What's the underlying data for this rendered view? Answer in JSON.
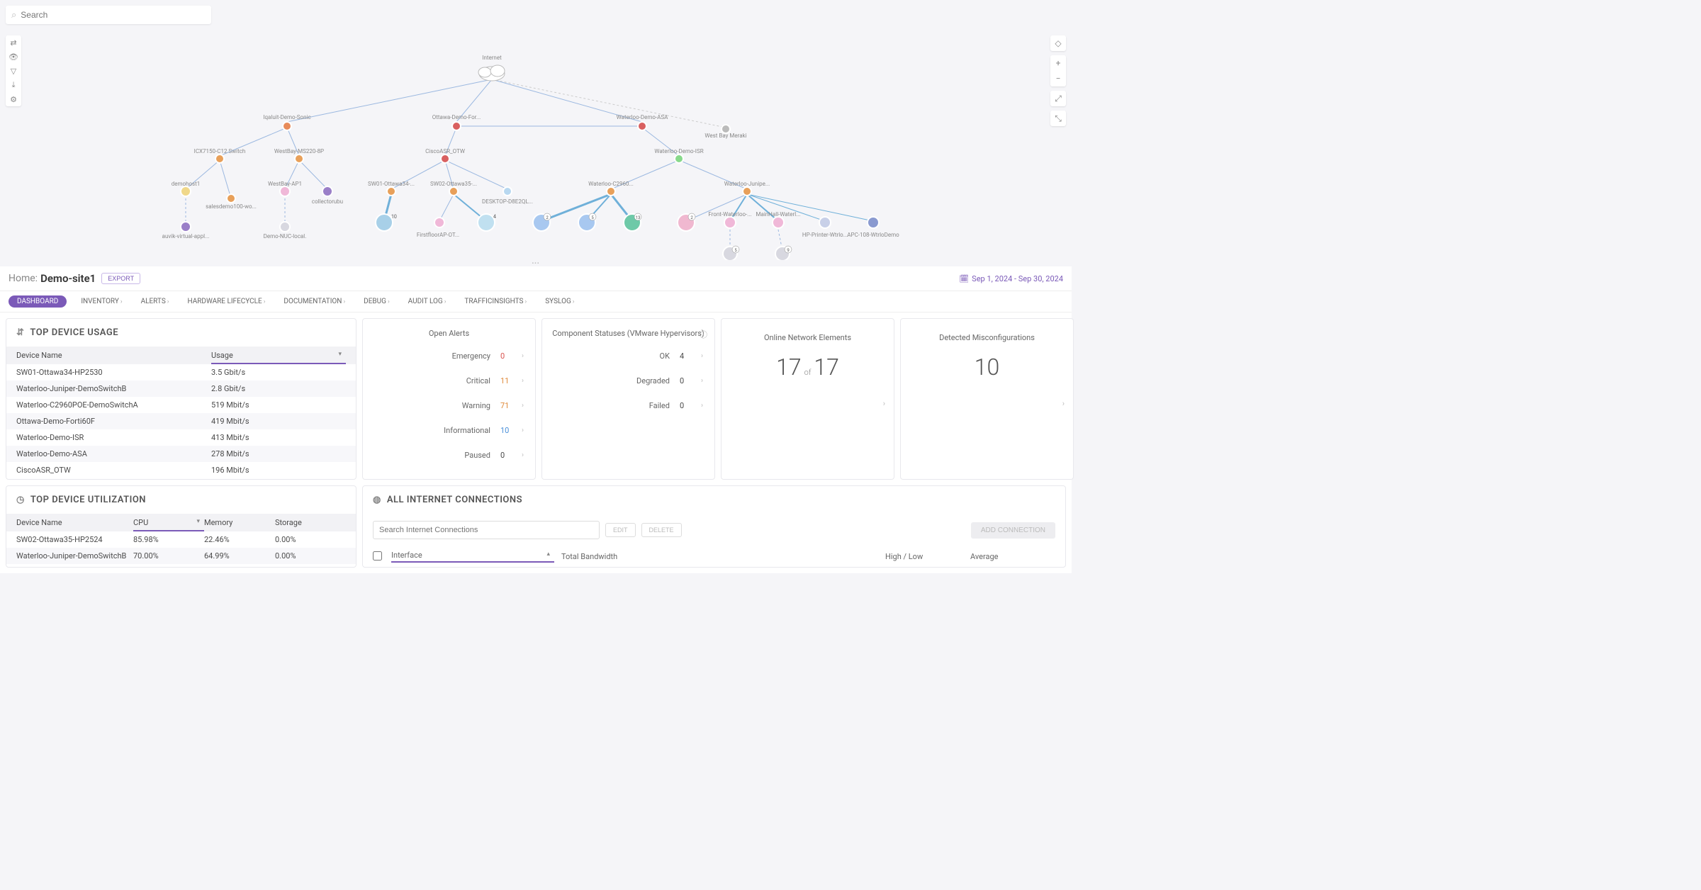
{
  "search": {
    "placeholder": "Search"
  },
  "date_range": "Sep 1, 2024 - Sep 30, 2024",
  "breadcrumb": {
    "home": "Home:",
    "site": "Demo-site1",
    "export": "EXPORT"
  },
  "tabs": [
    "DASHBOARD",
    "INVENTORY",
    "ALERTS",
    "HARDWARE LIFECYCLE",
    "DOCUMENTATION",
    "DEBUG",
    "AUDIT LOG",
    "TRAFFICINSIGHTS",
    "SYSLOG"
  ],
  "topology": {
    "root": "Internet",
    "nodes": {
      "iqaluit": "Iqaluit-Demo-Sonic",
      "ottawa": "Ottawa-Demo-For...",
      "waterloo": "Waterloo-Demo-ASA",
      "westbay": "West Bay Meraki",
      "icx": "ICX7150-C12 Switch",
      "ms220": "WestBay-MS220-8P",
      "ciscoasr": "CiscoASR_OTW",
      "isr": "Waterloo-Demo-ISR",
      "demohost": "demohost1",
      "westbayap": "WestBay-AP1",
      "collector": "collectorubu",
      "sw01": "SW01-Ottawa34-...",
      "sw02": "SW02-Ottawa35-...",
      "desktop": "DESKTOP-D8E2QL...",
      "c2960": "Waterloo-C2960...",
      "junipe": "Waterloo-Junipe...",
      "auvik": "auvik-virtual-appl...",
      "salesdemo": "salesdemo100-wo...",
      "demonuc": "Demo-NUC-local.",
      "firstfloor": "FirstfloorAP-OT...",
      "front": "Front-Waterloo-...",
      "mainhall": "MainHall-Waterl...",
      "hpprinter": "HP-Printer-Wtrlo...",
      "apc": "APC-108-WtrloDemo"
    },
    "badges": {
      "sw01b": "10",
      "sw02b": "4",
      "c2960_a": "2",
      "c2960_b": "5",
      "c2960_c": "13",
      "junipe_a": "2",
      "front_b": "5",
      "mainhall_b": "9"
    }
  },
  "top_usage": {
    "title": "TOP DEVICE USAGE",
    "cols": [
      "Device Name",
      "Usage"
    ],
    "rows": [
      {
        "name": "SW01-Ottawa34-HP2530",
        "usage": "3.5 Gbit/s"
      },
      {
        "name": "Waterloo-Juniper-DemoSwitchB",
        "usage": "2.8 Gbit/s"
      },
      {
        "name": "Waterloo-C2960POE-DemoSwitchA",
        "usage": "519 Mbit/s"
      },
      {
        "name": "Ottawa-Demo-Forti60F",
        "usage": "419 Mbit/s"
      },
      {
        "name": "Waterloo-Demo-ISR",
        "usage": "413 Mbit/s"
      },
      {
        "name": "Waterloo-Demo-ASA",
        "usage": "278 Mbit/s"
      },
      {
        "name": "CiscoASR_OTW",
        "usage": "196 Mbit/s"
      }
    ]
  },
  "open_alerts": {
    "title": "Open Alerts",
    "rows": [
      {
        "label": "Emergency",
        "value": "0",
        "cls": "v-red"
      },
      {
        "label": "Critical",
        "value": "11",
        "cls": "v-orange"
      },
      {
        "label": "Warning",
        "value": "71",
        "cls": "v-orange"
      },
      {
        "label": "Informational",
        "value": "10",
        "cls": "v-blue"
      },
      {
        "label": "Paused",
        "value": "0",
        "cls": ""
      }
    ]
  },
  "comp_status": {
    "title": "Component Statuses (VMware Hypervisors)",
    "rows": [
      {
        "label": "OK",
        "value": "4"
      },
      {
        "label": "Degraded",
        "value": "0"
      },
      {
        "label": "Failed",
        "value": "0"
      }
    ]
  },
  "online_elems": {
    "label": "Online Network Elements",
    "v1": "17",
    "of": "of",
    "v2": "17"
  },
  "misconfig": {
    "label": "Detected Misconfigurations",
    "v": "10"
  },
  "top_util": {
    "title": "TOP DEVICE UTILIZATION",
    "cols": [
      "Device Name",
      "CPU",
      "Memory",
      "Storage"
    ],
    "rows": [
      {
        "name": "SW02-Ottawa35-HP2524",
        "cpu": "85.98%",
        "mem": "22.46%",
        "sto": "0.00%"
      },
      {
        "name": "Waterloo-Juniper-DemoSwitchB",
        "cpu": "70.00%",
        "mem": "64.99%",
        "sto": "0.00%"
      }
    ]
  },
  "connections": {
    "title": "ALL INTERNET CONNECTIONS",
    "placeholder": "Search Internet Connections",
    "edit": "EDIT",
    "delete": "DELETE",
    "add": "ADD CONNECTION",
    "cols": [
      "Interface",
      "Total Bandwidth",
      "High / Low",
      "Average"
    ]
  }
}
